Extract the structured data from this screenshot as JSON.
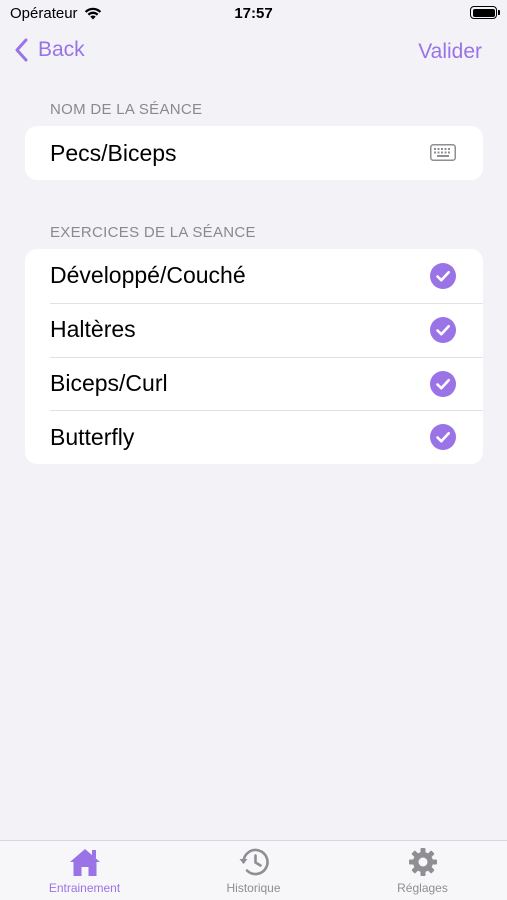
{
  "status_bar": {
    "carrier": "Opérateur",
    "time": "17:57"
  },
  "nav": {
    "back_label": "Back",
    "validate_label": "Valider"
  },
  "session_name": {
    "header": "NOM DE LA SÉANCE",
    "value": "Pecs/Biceps"
  },
  "exercises": {
    "header": "EXERCICES DE LA SÉANCE",
    "items": [
      {
        "label": "Développé/Couché",
        "checked": true
      },
      {
        "label": "Haltères",
        "checked": true
      },
      {
        "label": "Biceps/Curl",
        "checked": true
      },
      {
        "label": "Butterfly",
        "checked": true
      }
    ]
  },
  "tab_bar": {
    "tabs": [
      {
        "label": "Entrainement",
        "icon": "house-icon",
        "active": true
      },
      {
        "label": "Historique",
        "icon": "history-clock-icon",
        "active": false
      },
      {
        "label": "Réglages",
        "icon": "gear-icon",
        "active": false
      }
    ]
  },
  "colors": {
    "accent": "#9a73e6",
    "background": "#f2f2f7",
    "inactive_tab": "#8e8e93"
  }
}
